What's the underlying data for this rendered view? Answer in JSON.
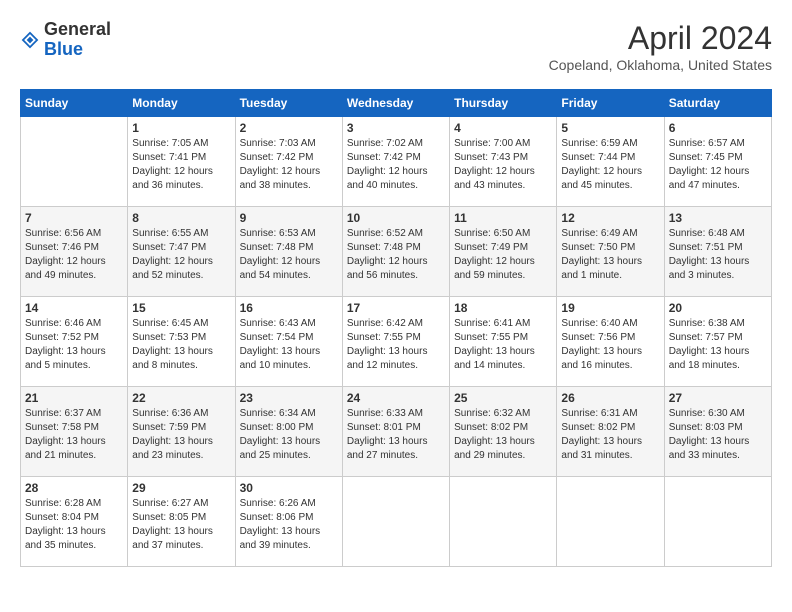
{
  "header": {
    "logo": {
      "line1": "General",
      "line2": "Blue"
    },
    "title": "April 2024",
    "location": "Copeland, Oklahoma, United States"
  },
  "calendar": {
    "headers": [
      "Sunday",
      "Monday",
      "Tuesday",
      "Wednesday",
      "Thursday",
      "Friday",
      "Saturday"
    ],
    "weeks": [
      [
        {
          "day": "",
          "sunrise": "",
          "sunset": "",
          "daylight": ""
        },
        {
          "day": "1",
          "sunrise": "Sunrise: 7:05 AM",
          "sunset": "Sunset: 7:41 PM",
          "daylight": "Daylight: 12 hours and 36 minutes."
        },
        {
          "day": "2",
          "sunrise": "Sunrise: 7:03 AM",
          "sunset": "Sunset: 7:42 PM",
          "daylight": "Daylight: 12 hours and 38 minutes."
        },
        {
          "day": "3",
          "sunrise": "Sunrise: 7:02 AM",
          "sunset": "Sunset: 7:42 PM",
          "daylight": "Daylight: 12 hours and 40 minutes."
        },
        {
          "day": "4",
          "sunrise": "Sunrise: 7:00 AM",
          "sunset": "Sunset: 7:43 PM",
          "daylight": "Daylight: 12 hours and 43 minutes."
        },
        {
          "day": "5",
          "sunrise": "Sunrise: 6:59 AM",
          "sunset": "Sunset: 7:44 PM",
          "daylight": "Daylight: 12 hours and 45 minutes."
        },
        {
          "day": "6",
          "sunrise": "Sunrise: 6:57 AM",
          "sunset": "Sunset: 7:45 PM",
          "daylight": "Daylight: 12 hours and 47 minutes."
        }
      ],
      [
        {
          "day": "7",
          "sunrise": "Sunrise: 6:56 AM",
          "sunset": "Sunset: 7:46 PM",
          "daylight": "Daylight: 12 hours and 49 minutes."
        },
        {
          "day": "8",
          "sunrise": "Sunrise: 6:55 AM",
          "sunset": "Sunset: 7:47 PM",
          "daylight": "Daylight: 12 hours and 52 minutes."
        },
        {
          "day": "9",
          "sunrise": "Sunrise: 6:53 AM",
          "sunset": "Sunset: 7:48 PM",
          "daylight": "Daylight: 12 hours and 54 minutes."
        },
        {
          "day": "10",
          "sunrise": "Sunrise: 6:52 AM",
          "sunset": "Sunset: 7:48 PM",
          "daylight": "Daylight: 12 hours and 56 minutes."
        },
        {
          "day": "11",
          "sunrise": "Sunrise: 6:50 AM",
          "sunset": "Sunset: 7:49 PM",
          "daylight": "Daylight: 12 hours and 59 minutes."
        },
        {
          "day": "12",
          "sunrise": "Sunrise: 6:49 AM",
          "sunset": "Sunset: 7:50 PM",
          "daylight": "Daylight: 13 hours and 1 minute."
        },
        {
          "day": "13",
          "sunrise": "Sunrise: 6:48 AM",
          "sunset": "Sunset: 7:51 PM",
          "daylight": "Daylight: 13 hours and 3 minutes."
        }
      ],
      [
        {
          "day": "14",
          "sunrise": "Sunrise: 6:46 AM",
          "sunset": "Sunset: 7:52 PM",
          "daylight": "Daylight: 13 hours and 5 minutes."
        },
        {
          "day": "15",
          "sunrise": "Sunrise: 6:45 AM",
          "sunset": "Sunset: 7:53 PM",
          "daylight": "Daylight: 13 hours and 8 minutes."
        },
        {
          "day": "16",
          "sunrise": "Sunrise: 6:43 AM",
          "sunset": "Sunset: 7:54 PM",
          "daylight": "Daylight: 13 hours and 10 minutes."
        },
        {
          "day": "17",
          "sunrise": "Sunrise: 6:42 AM",
          "sunset": "Sunset: 7:55 PM",
          "daylight": "Daylight: 13 hours and 12 minutes."
        },
        {
          "day": "18",
          "sunrise": "Sunrise: 6:41 AM",
          "sunset": "Sunset: 7:55 PM",
          "daylight": "Daylight: 13 hours and 14 minutes."
        },
        {
          "day": "19",
          "sunrise": "Sunrise: 6:40 AM",
          "sunset": "Sunset: 7:56 PM",
          "daylight": "Daylight: 13 hours and 16 minutes."
        },
        {
          "day": "20",
          "sunrise": "Sunrise: 6:38 AM",
          "sunset": "Sunset: 7:57 PM",
          "daylight": "Daylight: 13 hours and 18 minutes."
        }
      ],
      [
        {
          "day": "21",
          "sunrise": "Sunrise: 6:37 AM",
          "sunset": "Sunset: 7:58 PM",
          "daylight": "Daylight: 13 hours and 21 minutes."
        },
        {
          "day": "22",
          "sunrise": "Sunrise: 6:36 AM",
          "sunset": "Sunset: 7:59 PM",
          "daylight": "Daylight: 13 hours and 23 minutes."
        },
        {
          "day": "23",
          "sunrise": "Sunrise: 6:34 AM",
          "sunset": "Sunset: 8:00 PM",
          "daylight": "Daylight: 13 hours and 25 minutes."
        },
        {
          "day": "24",
          "sunrise": "Sunrise: 6:33 AM",
          "sunset": "Sunset: 8:01 PM",
          "daylight": "Daylight: 13 hours and 27 minutes."
        },
        {
          "day": "25",
          "sunrise": "Sunrise: 6:32 AM",
          "sunset": "Sunset: 8:02 PM",
          "daylight": "Daylight: 13 hours and 29 minutes."
        },
        {
          "day": "26",
          "sunrise": "Sunrise: 6:31 AM",
          "sunset": "Sunset: 8:02 PM",
          "daylight": "Daylight: 13 hours and 31 minutes."
        },
        {
          "day": "27",
          "sunrise": "Sunrise: 6:30 AM",
          "sunset": "Sunset: 8:03 PM",
          "daylight": "Daylight: 13 hours and 33 minutes."
        }
      ],
      [
        {
          "day": "28",
          "sunrise": "Sunrise: 6:28 AM",
          "sunset": "Sunset: 8:04 PM",
          "daylight": "Daylight: 13 hours and 35 minutes."
        },
        {
          "day": "29",
          "sunrise": "Sunrise: 6:27 AM",
          "sunset": "Sunset: 8:05 PM",
          "daylight": "Daylight: 13 hours and 37 minutes."
        },
        {
          "day": "30",
          "sunrise": "Sunrise: 6:26 AM",
          "sunset": "Sunset: 8:06 PM",
          "daylight": "Daylight: 13 hours and 39 minutes."
        },
        {
          "day": "",
          "sunrise": "",
          "sunset": "",
          "daylight": ""
        },
        {
          "day": "",
          "sunrise": "",
          "sunset": "",
          "daylight": ""
        },
        {
          "day": "",
          "sunrise": "",
          "sunset": "",
          "daylight": ""
        },
        {
          "day": "",
          "sunrise": "",
          "sunset": "",
          "daylight": ""
        }
      ]
    ]
  }
}
